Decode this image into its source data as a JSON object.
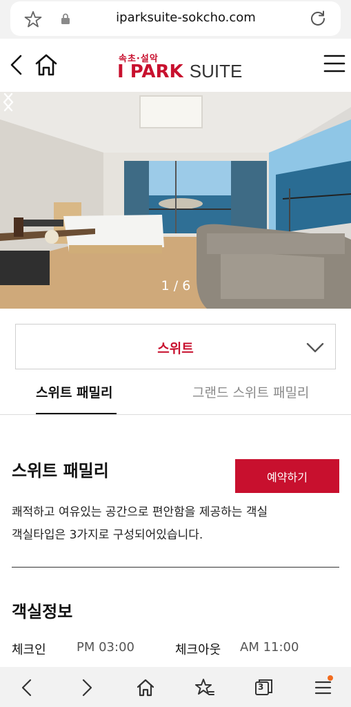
{
  "browser": {
    "url": "iparksuite-sokcho.com",
    "tab_count": "3"
  },
  "header": {
    "logo_sub": "속초·설악",
    "logo_brand": "I PARK",
    "logo_suite": "SUITE"
  },
  "hero": {
    "counter": "1 / 6"
  },
  "room_select": {
    "value": "스위트"
  },
  "tabs": [
    {
      "label": "스위트 패밀리",
      "active": true
    },
    {
      "label": "그랜드 스위트 패밀리",
      "active": false
    }
  ],
  "room": {
    "title": "스위트 패밀리",
    "reserve_label": "예약하기",
    "description_line1": "쾌적하고 여유있는 공간으로 편안함을 제공하는 객실",
    "description_line2": "객실타입은 3가지로 구성되어있습니다."
  },
  "room_info": {
    "title": "객실정보",
    "checkin_label": "체크인",
    "checkin_value": "PM 03:00",
    "checkout_label": "체크아웃",
    "checkout_value": "AM 11:00"
  },
  "colors": {
    "brand": "#c8102e",
    "notification": "#f26c1f"
  }
}
